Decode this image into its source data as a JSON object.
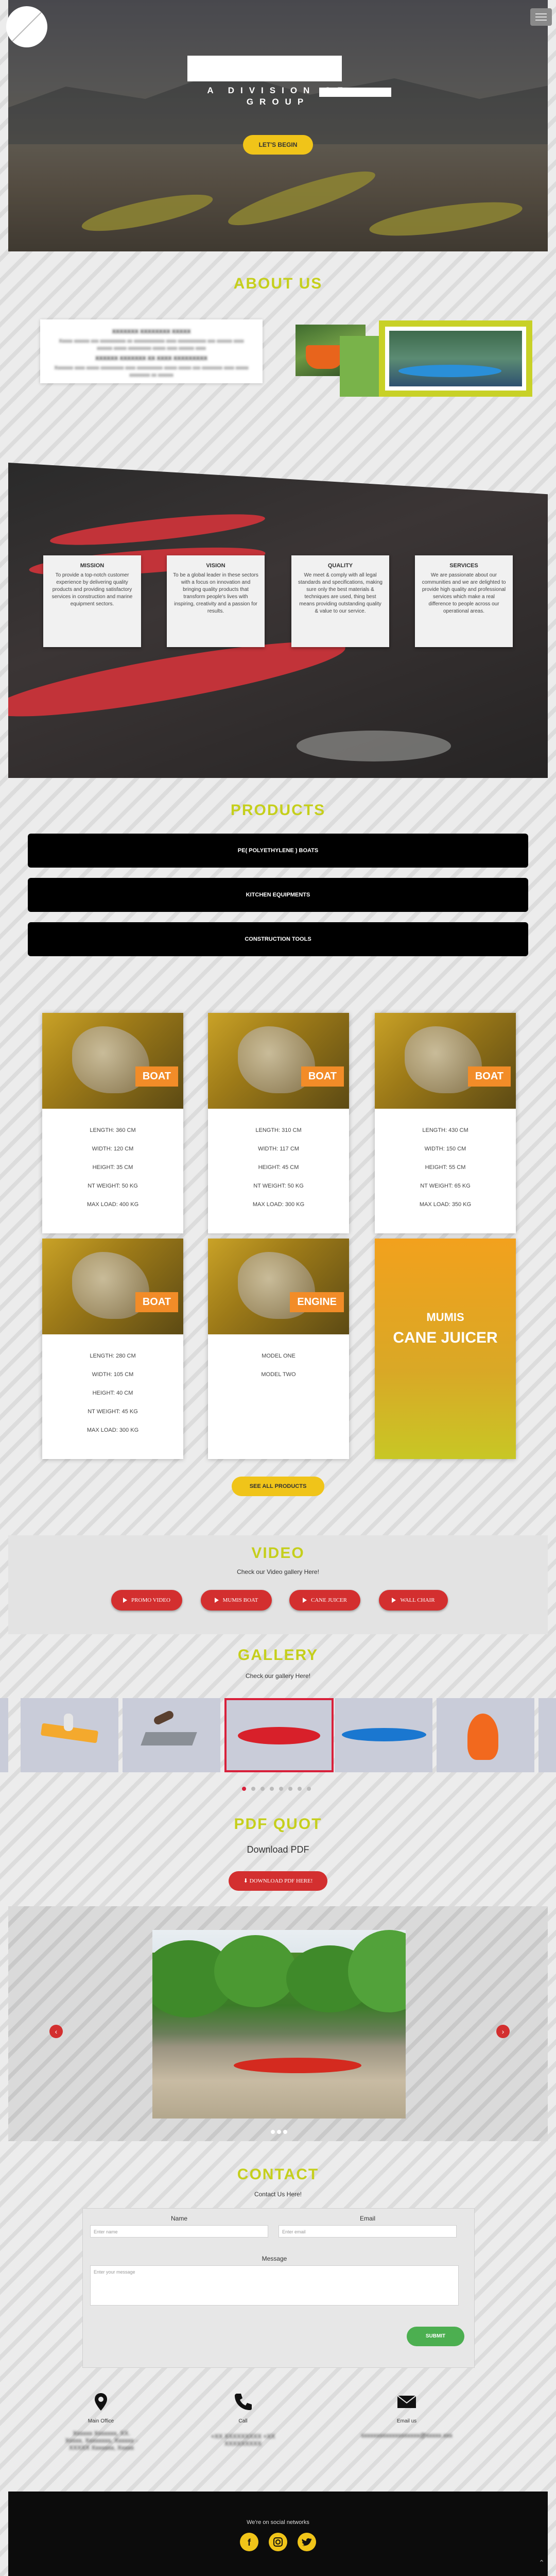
{
  "hero": {
    "line1": "A DIVISION OF",
    "line2": "GROUP",
    "begin_button": "LET'S BEGIN"
  },
  "about": {
    "title": "ABOUT US",
    "card_heading_1": "XXXXXXX XXXXXXXX XXXXX",
    "card_text_1": "Xxxxx xxxxxx xxx xxxxxxxxxx xx xxxxxxxxxxxx xxxx xxxxxxxxxxx xxx xxxxxx xxxx xxxxxx xxxxx xxxxxxxxx xxxxx xxxx xxxxxx xxxx",
    "card_heading_2": "XXXXXX XXXXXXX XX XXXX XXXXXXXXX",
    "card_text_2": "Xxxxxxx xxxx xxxxx xxxxxxxxx xxxx xxxxxxxxxx xxxxx xxxxx xxx xxxxxxxx xxxx xxxxx xxxxxxxx xx xxxxxx",
    "cards": [
      {
        "title": "MISSION",
        "text": "To provide a top-notch customer experience by delivering quality products and providing satisfactory services in construction and marine equipment sectors."
      },
      {
        "title": "VISION",
        "text": "To be a global leader in these sectors with a focus on innovation and bringing quality products that transform people's lives with inspiring, creativity and a passion for results."
      },
      {
        "title": "QUALITY",
        "text": "We meet & comply with all legal standards and specifications, making sure only the best materials & techniques are used, thing best means providing outstanding quality & value to our service."
      },
      {
        "title": "SERVICES",
        "text": "We are passionate about our communities and we are delighted to provide high quality and professional services which make a real difference to people across our operational areas."
      }
    ]
  },
  "products": {
    "title": "PRODUCTS",
    "categories": [
      "PE( POLYETHYLENE ) BOATS",
      "KITCHEN EQUIPMENTS",
      "CONSTRUCTION TOOLS"
    ],
    "items": [
      {
        "badge": "BOAT",
        "specs": [
          "LENGTH: 360 CM",
          "WIDTH: 120 CM",
          "HEIGHT: 35 CM",
          "NT WEIGHT: 50 KG",
          "MAX LOAD: 400 KG"
        ]
      },
      {
        "badge": "BOAT",
        "specs": [
          "LENGTH: 310 CM",
          "WIDTH: 117 CM",
          "HEIGHT: 45 CM",
          "NT WEIGHT: 50 KG",
          "MAX LOAD: 300 KG"
        ]
      },
      {
        "badge": "BOAT",
        "specs": [
          "LENGTH: 430 CM",
          "WIDTH: 150 CM",
          "HEIGHT: 55 CM",
          "NT WEIGHT: 65 KG",
          "MAX LOAD: 350 KG"
        ]
      },
      {
        "badge": "BOAT",
        "specs": [
          "LENGTH: 280 CM",
          "WIDTH: 105 CM",
          "HEIGHT: 40 CM",
          "NT WEIGHT: 45 KG",
          "MAX LOAD: 300 KG"
        ]
      },
      {
        "badge": "ENGINE",
        "specs": [
          "MODEL ONE",
          "MODEL TWO"
        ]
      }
    ],
    "juicer_line1": "MUMIS",
    "juicer_line2": "CANE JUICER",
    "see_all": "SEE ALL PRODUCTS"
  },
  "video": {
    "title": "VIDEO",
    "subtitle": "Check our Video gallery Here!",
    "buttons": [
      "PROMO VIDEO",
      "MUMIS BOAT",
      "CANE JUICER",
      "WALL CHAIR"
    ]
  },
  "gallery": {
    "title": "GALLERY",
    "subtitle": "Check our gallery Here!"
  },
  "pdf": {
    "title": "PDF QUOT",
    "subtitle": "Download PDF",
    "button": "DOWNLOAD PDF HERE!"
  },
  "contact": {
    "title": "CONTACT",
    "subtitle": "Contact Us Here!",
    "name_label": "Name",
    "email_label": "Email",
    "message_label": "Message",
    "name_placeholder": "Enter name",
    "email_placeholder": "Enter email",
    "message_placeholder": "Enter your message",
    "submit": "SUBMIT",
    "office_label": "Main Office",
    "call_label": "Call",
    "email_us_label": "Email us",
    "office_blur": "Xxxxxx Xxxxxxx, XX. Xxxxx, Xxxxxxxx, Xxxxxx - XXXXX Xxxxxxx, Xxxxx",
    "call_blur": "+XX XXXXXXXXX +XX XXXXXXXXX",
    "email_blur": "xxxxxxxxxxxxxxxxxxx@xxxxx.xxx"
  },
  "footer": {
    "social_text": "We're on social networks"
  },
  "colors": {
    "accent_green": "#c5cf1c",
    "accent_yellow": "#f0c419",
    "button_red": "#d32f2f",
    "badge_orange": "#f28c28"
  }
}
